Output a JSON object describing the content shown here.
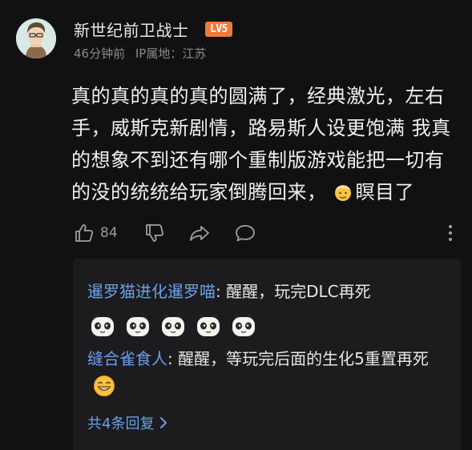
{
  "user": {
    "name": "新世纪前卫战士",
    "level_badge": "LV5",
    "time": "46分钟前",
    "ip_location": "IP属地：江苏"
  },
  "post": {
    "text_main": "真的真的真的真的圆满了，经典激光，左右手，威斯克新剧情，路易斯人设更饱满 我真的想象不到还有哪个重制版游戏能把一切有的没的统统给玩家倒腾回来，",
    "text_tail": "瞑目了",
    "inline_emoji": "old-man-emoji"
  },
  "actions": {
    "like_count": "84"
  },
  "replies": [
    {
      "name": "暹罗猫进化暹罗喵",
      "text": ": 醒醒，玩完DLC再死",
      "stickers": [
        "panda-sticker",
        "panda-sticker",
        "panda-sticker",
        "panda-sticker",
        "panda-sticker"
      ]
    },
    {
      "name": "缝合雀食人",
      "text": ": 醒醒，等玩完后面的生化5重置再死",
      "emoji": "grin-emoji"
    }
  ],
  "more_replies_label": "共4条回复"
}
